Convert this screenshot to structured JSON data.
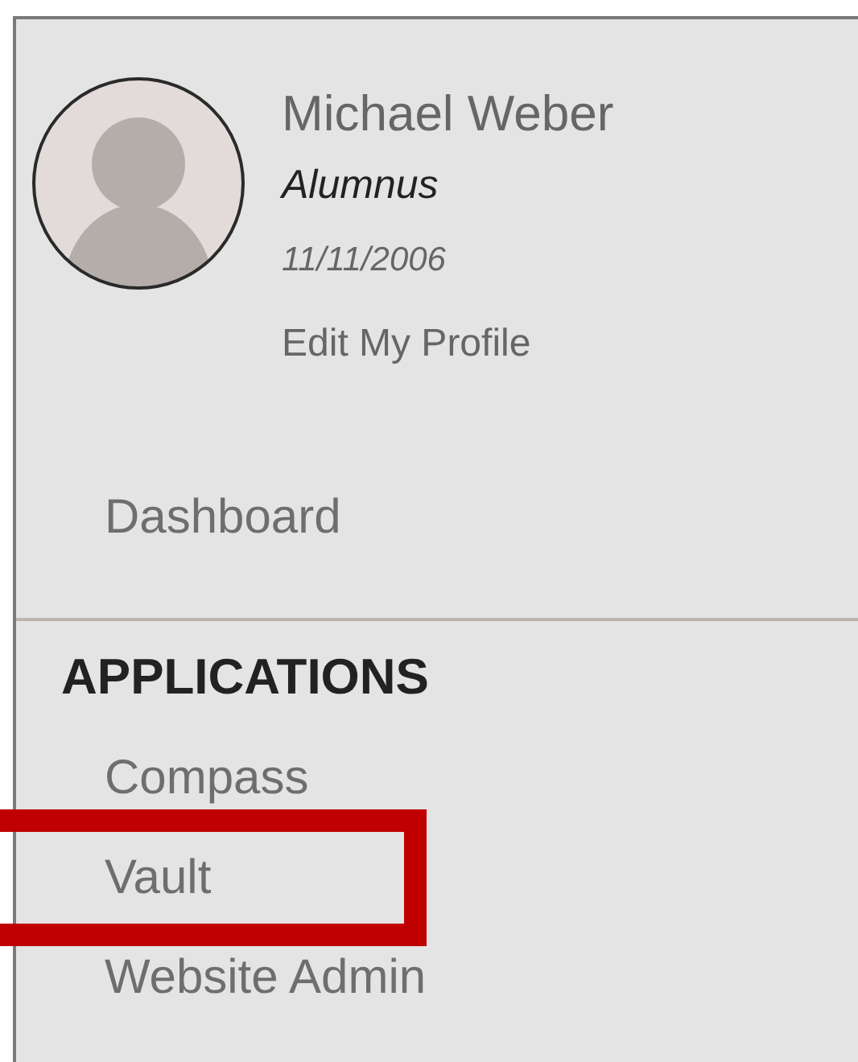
{
  "profile": {
    "name": "Michael Weber",
    "role": "Alumnus",
    "date": "11/11/2006",
    "edit_link": "Edit My Profile"
  },
  "nav": [
    {
      "label": "Dashboard"
    }
  ],
  "applications": {
    "heading": "APPLICATIONS",
    "items": [
      {
        "label": "Compass",
        "highlighted": false
      },
      {
        "label": "Vault",
        "highlighted": true
      },
      {
        "label": "Website Admin",
        "highlighted": false
      }
    ]
  }
}
